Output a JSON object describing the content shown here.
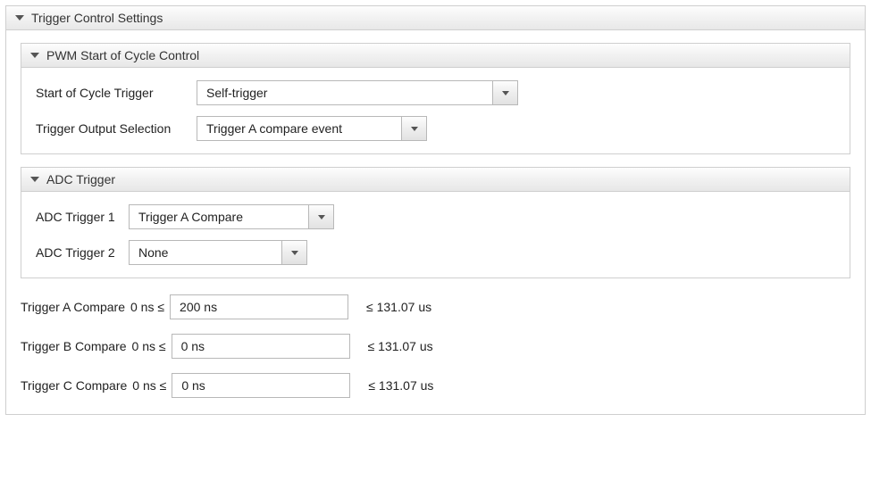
{
  "main": {
    "title": "Trigger Control Settings"
  },
  "pwm": {
    "title": "PWM Start of Cycle Control",
    "rows": {
      "start_trigger": {
        "label": "Start of Cycle Trigger",
        "value": "Self-trigger"
      },
      "output_selection": {
        "label": "Trigger Output Selection",
        "value": "Trigger A compare event"
      }
    }
  },
  "adc": {
    "title": "ADC Trigger",
    "rows": {
      "trigger1": {
        "label": "ADC Trigger 1",
        "value": "Trigger A Compare"
      },
      "trigger2": {
        "label": "ADC Trigger 2",
        "value": "None"
      }
    }
  },
  "compare": {
    "a": {
      "label": "Trigger A Compare",
      "min": "0 ns  ≤",
      "value": "200 ns",
      "max": "≤  131.07 us"
    },
    "b": {
      "label": "Trigger B Compare",
      "min": "0 ns  ≤",
      "value": "0 ns",
      "max": "≤  131.07 us"
    },
    "c": {
      "label": "Trigger C Compare",
      "min": "0 ns  ≤",
      "value": "0 ns",
      "max": "≤  131.07 us"
    }
  }
}
